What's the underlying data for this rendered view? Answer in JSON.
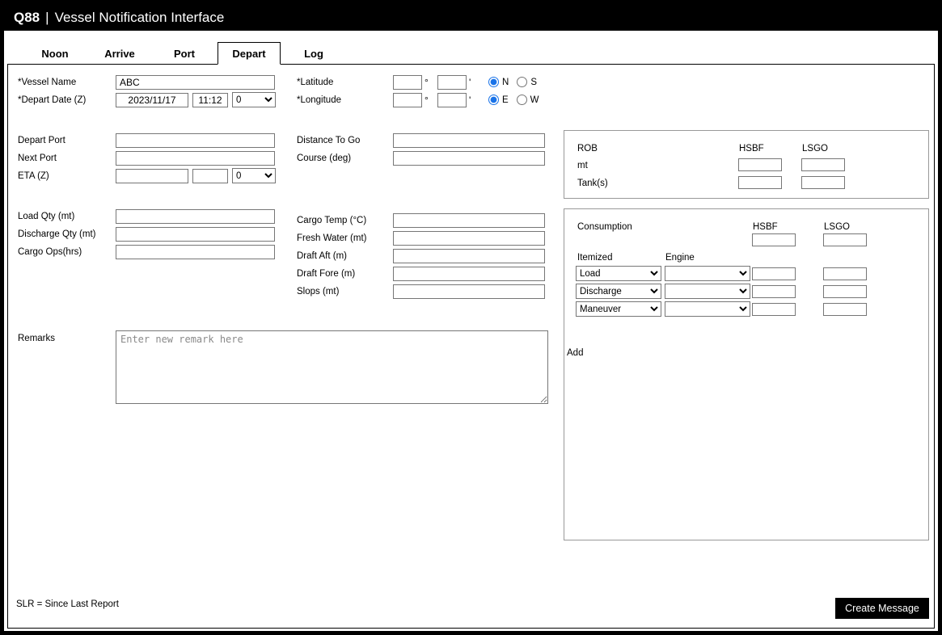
{
  "titlebar": {
    "brand": "Q88",
    "divider": "|",
    "title": "Vessel Notification Interface"
  },
  "tabs": [
    {
      "label": "Noon",
      "active": false
    },
    {
      "label": "Arrive",
      "active": false
    },
    {
      "label": "Port",
      "active": false
    },
    {
      "label": "Depart",
      "active": true
    },
    {
      "label": "Log",
      "active": false
    }
  ],
  "form": {
    "vessel_name": {
      "label": "*Vessel Name",
      "value": "ABC"
    },
    "depart_date": {
      "label": "*Depart Date (Z)",
      "date": "2023/11/17",
      "time": "11:12",
      "offset": "0"
    },
    "latitude": {
      "label": "*Latitude",
      "degrees": "",
      "minutes": "",
      "degree_symbol": "°",
      "minute_symbol": "'",
      "hemisphere_options": [
        "N",
        "S"
      ],
      "hemisphere_selected": "N"
    },
    "longitude": {
      "label": "*Longitude",
      "degrees": "",
      "minutes": "",
      "degree_symbol": "°",
      "minute_symbol": "'",
      "hemisphere_options": [
        "E",
        "W"
      ],
      "hemisphere_selected": "E"
    },
    "depart_port": {
      "label": "Depart Port",
      "value": ""
    },
    "next_port": {
      "label": "Next Port",
      "value": ""
    },
    "eta": {
      "label": "ETA (Z)",
      "date": "",
      "time": "",
      "offset": "0"
    },
    "distance_to_go": {
      "label": "Distance To Go",
      "value": ""
    },
    "course": {
      "label": "Course (deg)",
      "value": ""
    },
    "load_qty": {
      "label": "Load Qty (mt)",
      "value": ""
    },
    "discharge_qty": {
      "label": "Discharge Qty (mt)",
      "value": ""
    },
    "cargo_ops": {
      "label": "Cargo Ops(hrs)",
      "value": ""
    },
    "cargo_temp": {
      "label": "Cargo Temp (°C)",
      "value": ""
    },
    "fresh_water": {
      "label": "Fresh Water (mt)",
      "value": ""
    },
    "draft_aft": {
      "label": "Draft Aft (m)",
      "value": ""
    },
    "draft_fore": {
      "label": "Draft Fore (m)",
      "value": ""
    },
    "slops": {
      "label": "Slops (mt)",
      "value": ""
    },
    "remarks": {
      "label": "Remarks",
      "placeholder": "Enter new remark here",
      "value": ""
    }
  },
  "rob": {
    "title": "ROB",
    "columns": [
      "HSBF",
      "LSGO"
    ],
    "rows": [
      {
        "label": "mt",
        "hsbf": "",
        "lsgo": ""
      },
      {
        "label": "Tank(s)",
        "hsbf": "",
        "lsgo": ""
      }
    ]
  },
  "consumption": {
    "title": "Consumption",
    "columns": [
      "HSBF",
      "LSGO"
    ],
    "totals": {
      "hsbf": "",
      "lsgo": ""
    },
    "itemized_header": "Itemized",
    "engine_header": "Engine",
    "rows": [
      {
        "itemized": "Load",
        "engine": "",
        "hsbf": "",
        "lsgo": ""
      },
      {
        "itemized": "Discharge",
        "engine": "",
        "hsbf": "",
        "lsgo": ""
      },
      {
        "itemized": "Maneuver",
        "engine": "",
        "hsbf": "",
        "lsgo": ""
      }
    ],
    "add_label": "Add"
  },
  "footer": {
    "note": "SLR = Since Last Report",
    "create_button_label": "Create Message"
  },
  "colors": {
    "titlebar_bg": "#000000",
    "create_button_bg": "#000000",
    "radio_accent": "#1a73e8"
  }
}
